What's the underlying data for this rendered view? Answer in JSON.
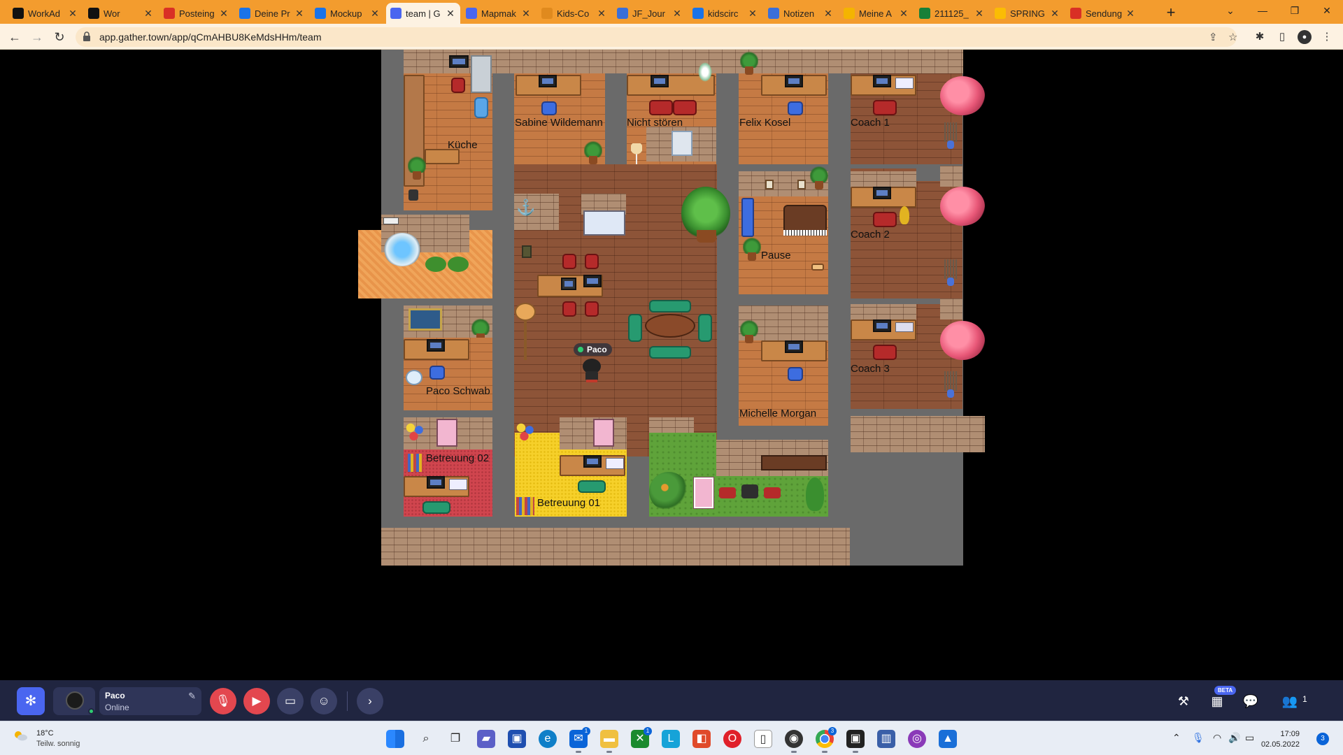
{
  "browser": {
    "tabs": [
      {
        "title": "WorkAd",
        "favicon_color": "#111111"
      },
      {
        "title": "Wor",
        "favicon_color": "#111111"
      },
      {
        "title": "Posteing",
        "favicon_color": "#d93025"
      },
      {
        "title": "Deine Pr",
        "favicon_color": "#1a73e8"
      },
      {
        "title": "Mockup",
        "favicon_color": "#1a73e8"
      },
      {
        "title": "team | G",
        "favicon_color": "#4a66f0"
      },
      {
        "title": "Mapmak",
        "favicon_color": "#4a66f0"
      },
      {
        "title": "Kids-Co",
        "favicon_color": "#e08a1e"
      },
      {
        "title": "JF_Jour",
        "favicon_color": "#3b6fd8"
      },
      {
        "title": "kidscirc",
        "favicon_color": "#1a73e8"
      },
      {
        "title": "Notizen",
        "favicon_color": "#3b6fd8"
      },
      {
        "title": "Meine A",
        "favicon_color": "#f4b400"
      },
      {
        "title": "211125_",
        "favicon_color": "#188038"
      },
      {
        "title": "SPRING",
        "favicon_color": "#fbbc04"
      },
      {
        "title": "Sendung",
        "favicon_color": "#d93025"
      }
    ],
    "active_tab_index": 5,
    "url": "app.gather.town/app/qCmAHBU8KeMdsHHm/team",
    "icons": {
      "back": "arrow-left-icon",
      "forward": "arrow-right-icon",
      "reload": "reload-icon",
      "share": "share-icon",
      "bookmark": "star-icon",
      "extensions": "puzzle-icon",
      "sidebar": "sidebar-icon",
      "profile": "profile-icon",
      "menu": "kebab-menu-icon"
    }
  },
  "map": {
    "room_labels": {
      "kueche": "Küche",
      "sabine": "Sabine Wildemann",
      "nicht_stoeren": "Nicht stören",
      "felix": "Felix Kosel",
      "coach1": "Coach 1",
      "coach2": "Coach 2",
      "pause": "Pause",
      "coach3": "Coach 3",
      "paco_schwab": "Paco Schwab",
      "michelle": "Michelle Morgan",
      "betreuung02": "Betreuung 02",
      "betreuung01": "Betreuung 01"
    },
    "player": {
      "name": "Paco",
      "status_color": "#2ecc71"
    }
  },
  "gather_bar": {
    "user_name": "Paco",
    "user_status": "Online",
    "beta_label": "BETA",
    "participants_count": "1"
  },
  "taskbar": {
    "weather_temp": "18°C",
    "weather_desc": "Teilw. sonnig",
    "time": "17:09",
    "date": "02.05.2022",
    "notification_count": "3",
    "badges": {
      "mail": "1",
      "xbox": "1",
      "chrome": "3"
    }
  }
}
